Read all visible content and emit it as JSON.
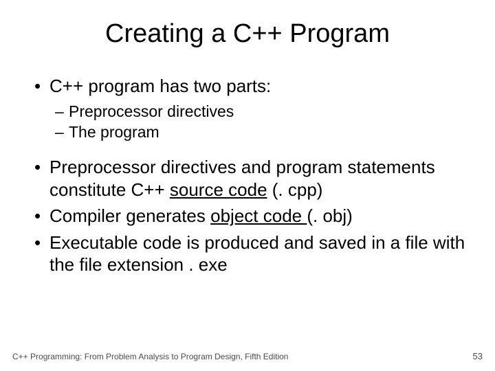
{
  "title": "Creating a C++ Program",
  "bullets": {
    "b1": "C++ program has two parts:",
    "b1a": "Preprocessor directives",
    "b1b": "The program",
    "b2_pre": "Preprocessor directives and program statements constitute C++ ",
    "b2_underlined": "source code",
    "b2_post": " (. cpp)",
    "b3_pre": "Compiler generates ",
    "b3_underlined": "object code ",
    "b3_post": "(. obj)",
    "b4": "Executable code is produced and saved in a file with the file extension . exe"
  },
  "footer": {
    "text": "C++ Programming: From Problem Analysis to Program Design, Fifth Edition",
    "page": "53"
  }
}
